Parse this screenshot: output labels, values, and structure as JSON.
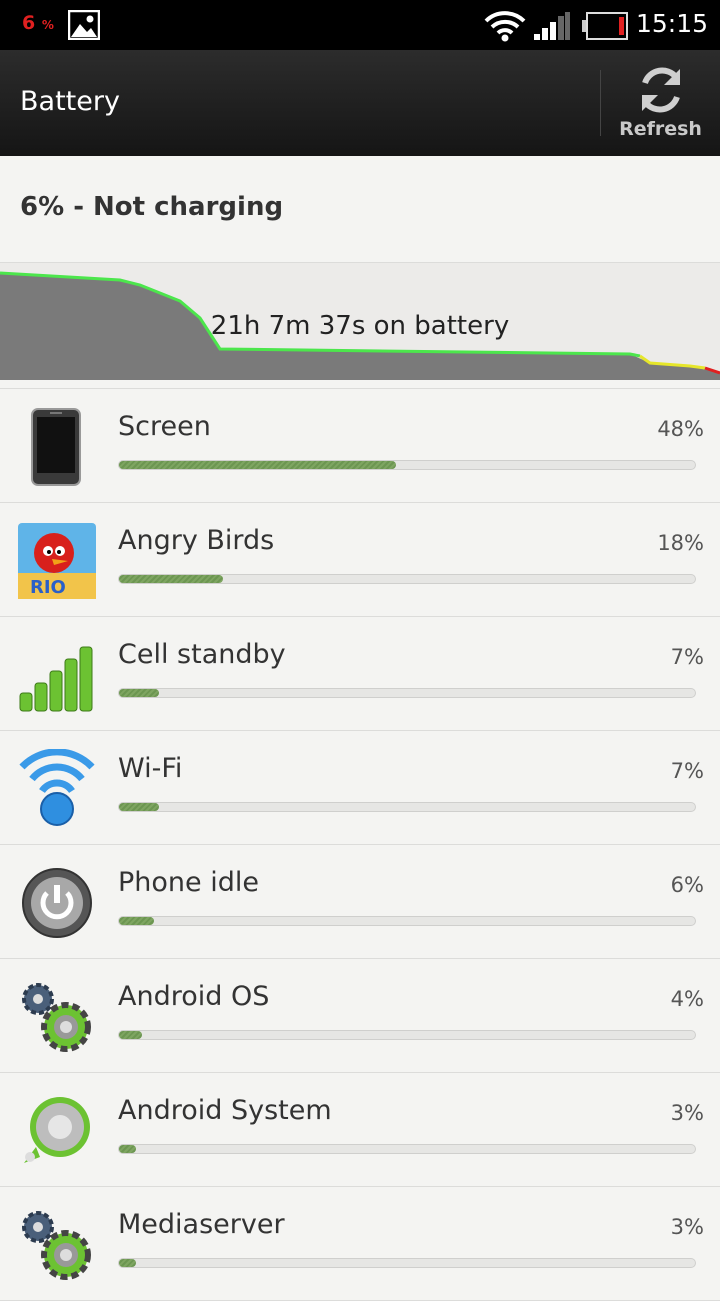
{
  "status_bar": {
    "battery_percent": "6",
    "battery_percent_unit": "%",
    "time": "15:15",
    "icons": [
      "image-icon",
      "wifi-icon",
      "signal-icon",
      "battery-icon"
    ]
  },
  "action_bar": {
    "title": "Battery",
    "refresh_label": "Refresh"
  },
  "summary": {
    "text": "6% - Not charging"
  },
  "graph": {
    "label": "21h 7m 37s on battery",
    "colors": {
      "high": "#4ce64c",
      "medium": "#e6e62a",
      "low": "#e02020",
      "fill": "#7a7a7a"
    }
  },
  "usage": [
    {
      "name": "Screen",
      "percent": "48%",
      "value": 48,
      "icon": "phone-icon"
    },
    {
      "name": "Angry Birds",
      "percent": "18%",
      "value": 18,
      "icon": "angry-birds-icon"
    },
    {
      "name": "Cell standby",
      "percent": "7%",
      "value": 7,
      "icon": "cell-signal-icon"
    },
    {
      "name": "Wi-Fi",
      "percent": "7%",
      "value": 7,
      "icon": "wifi-icon"
    },
    {
      "name": "Phone idle",
      "percent": "6%",
      "value": 6,
      "icon": "power-icon"
    },
    {
      "name": "Android OS",
      "percent": "4%",
      "value": 4,
      "icon": "gears-icon"
    },
    {
      "name": "Android System",
      "percent": "3%",
      "value": 3,
      "icon": "android-system-icon"
    },
    {
      "name": "Mediaserver",
      "percent": "3%",
      "value": 3,
      "icon": "gears-icon"
    }
  ]
}
